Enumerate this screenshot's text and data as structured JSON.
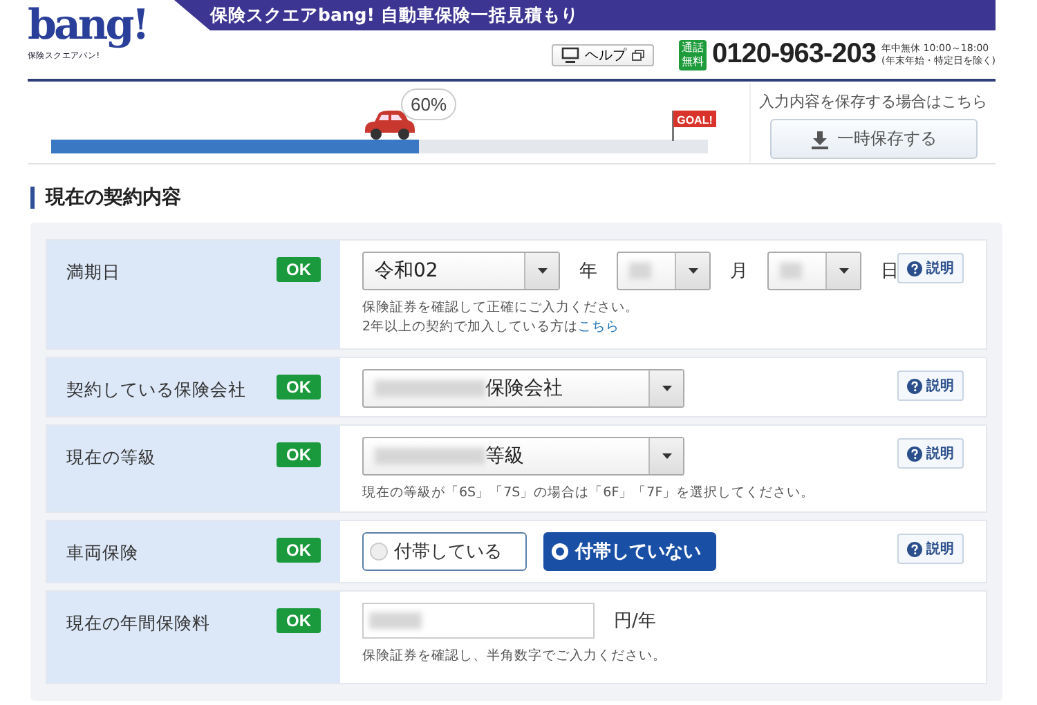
{
  "header": {
    "title": "保険スクエアbang! 自動車保険一括見積もり",
    "logo": {
      "text": "bang!",
      "subtext": "保険スクエアバン!"
    },
    "help_button": "ヘルプ",
    "phone": {
      "badge": [
        "通話",
        "無料"
      ],
      "number": "0120-963-203",
      "hours": [
        "年中無休 10:00～18:00",
        "(年末年始・特定日を除く)"
      ]
    }
  },
  "progress": {
    "level": 0.56,
    "percent": "60%",
    "goal": "GOAL!"
  },
  "save": {
    "note": "入力内容を保存する場合はこちら",
    "button": "一時保存する"
  },
  "section_title": "現在の契約内容",
  "rows": [
    {
      "kind": "date",
      "label": "満期日",
      "status": "OK",
      "help": "説明",
      "selects": [
        {
          "value": "令和02",
          "redacted": false,
          "unit": "年"
        },
        {
          "redacted": true,
          "unit": "月"
        },
        {
          "redacted": true,
          "unit": "日"
        }
      ],
      "notes": [
        {
          "text": "保険証券を確認して正確にご入力ください。"
        },
        {
          "text": "2年以上の契約で加入している方は",
          "link": "こちら"
        }
      ]
    },
    {
      "kind": "select",
      "label": "契約している保険会社",
      "status": "OK",
      "help": "説明",
      "select": {
        "value": "保険会社",
        "redacted": true
      }
    },
    {
      "kind": "select",
      "label": "現在の等級",
      "status": "OK",
      "help": "説明",
      "select": {
        "value": "等級",
        "redacted": true
      },
      "notes": [
        {
          "text": "現在の等級が「6S」「7S」の場合は「6F」「7F」を選択してください。"
        }
      ]
    },
    {
      "kind": "radio",
      "label": "車両保険",
      "status": "OK",
      "help": "説明",
      "options": [
        {
          "label": "付帯している",
          "selected": false
        },
        {
          "label": "付帯していない",
          "selected": true
        }
      ]
    },
    {
      "kind": "amount",
      "label": "現在の年間保険料",
      "status": "OK",
      "input": {
        "redacted": true
      },
      "unit": "円/年",
      "notes": [
        {
          "text": "保険証券を確認し、半角数字でご入力ください。"
        }
      ]
    }
  ]
}
